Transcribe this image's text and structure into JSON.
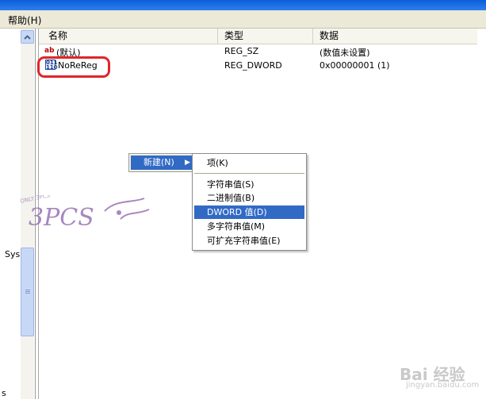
{
  "menubar": {
    "help_label": "帮助(H)"
  },
  "tree": {
    "label_sys": "Sys",
    "label_s": "s"
  },
  "list": {
    "columns": [
      "名称",
      "类型",
      "数据"
    ],
    "rows": [
      {
        "icon": "string-value-icon",
        "name": "(默认)",
        "type": "REG_SZ",
        "data": "(数值未设置)"
      },
      {
        "icon": "dword-value-icon",
        "name": "NoReReg",
        "type": "REG_DWORD",
        "data": "0x00000001 (1)"
      }
    ]
  },
  "context_menu": {
    "new_label": "新建(N)",
    "submenu": [
      "项(K)",
      "字符串值(S)",
      "二进制值(B)",
      "DWORD 值(D)",
      "多字符串值(M)",
      "可扩充字符串值(E)"
    ],
    "selected": "DWORD 值(D)"
  },
  "watermark": {
    "text_top": "ONLY 3PCS",
    "text_main": "3PCS"
  },
  "baidu": {
    "brand": "Bai 经验",
    "url": "jingyan.baidu.com"
  },
  "colors": {
    "menu_highlight": "#316ac5",
    "annotation_ring": "#e0252a",
    "titlebar": "#0a5fd8"
  }
}
